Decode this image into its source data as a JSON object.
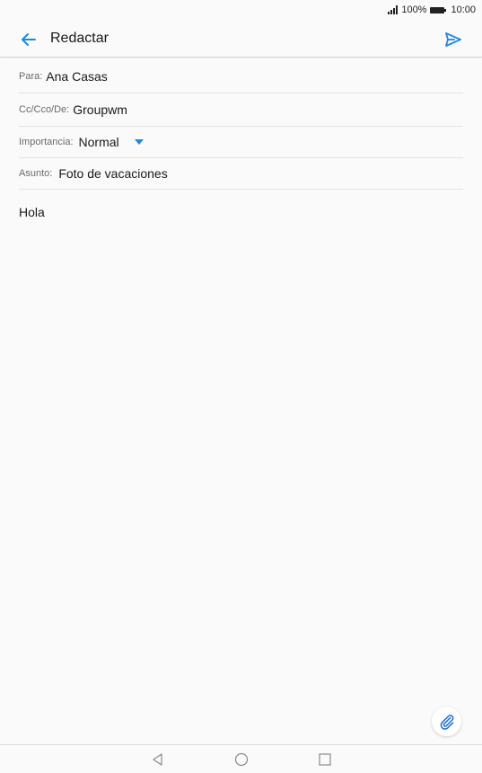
{
  "status_bar": {
    "battery_text": "100%",
    "time": "10:00",
    "icons": [
      "signal-icon",
      "battery-icon"
    ]
  },
  "header": {
    "title": "Redactar",
    "back_icon": "arrow-left-icon",
    "send_icon": "send-icon",
    "accent_color": "#1e88e5"
  },
  "form": {
    "to": {
      "label": "Para:",
      "value": "Ana Casas"
    },
    "cc": {
      "label": "Cc/Cco/De:",
      "value": "Groupwm"
    },
    "priority": {
      "label": "Importancia:",
      "value": "Normal",
      "icon": "dropdown-caret-icon"
    },
    "subject": {
      "label": "Asunto:",
      "value": "Foto de vacaciones"
    }
  },
  "message": {
    "body": "Hola"
  },
  "attach": {
    "icon": "paperclip-icon"
  },
  "nav_bar": {
    "icons": [
      "back-triangle-icon",
      "home-circle-icon",
      "recents-square-icon"
    ]
  }
}
